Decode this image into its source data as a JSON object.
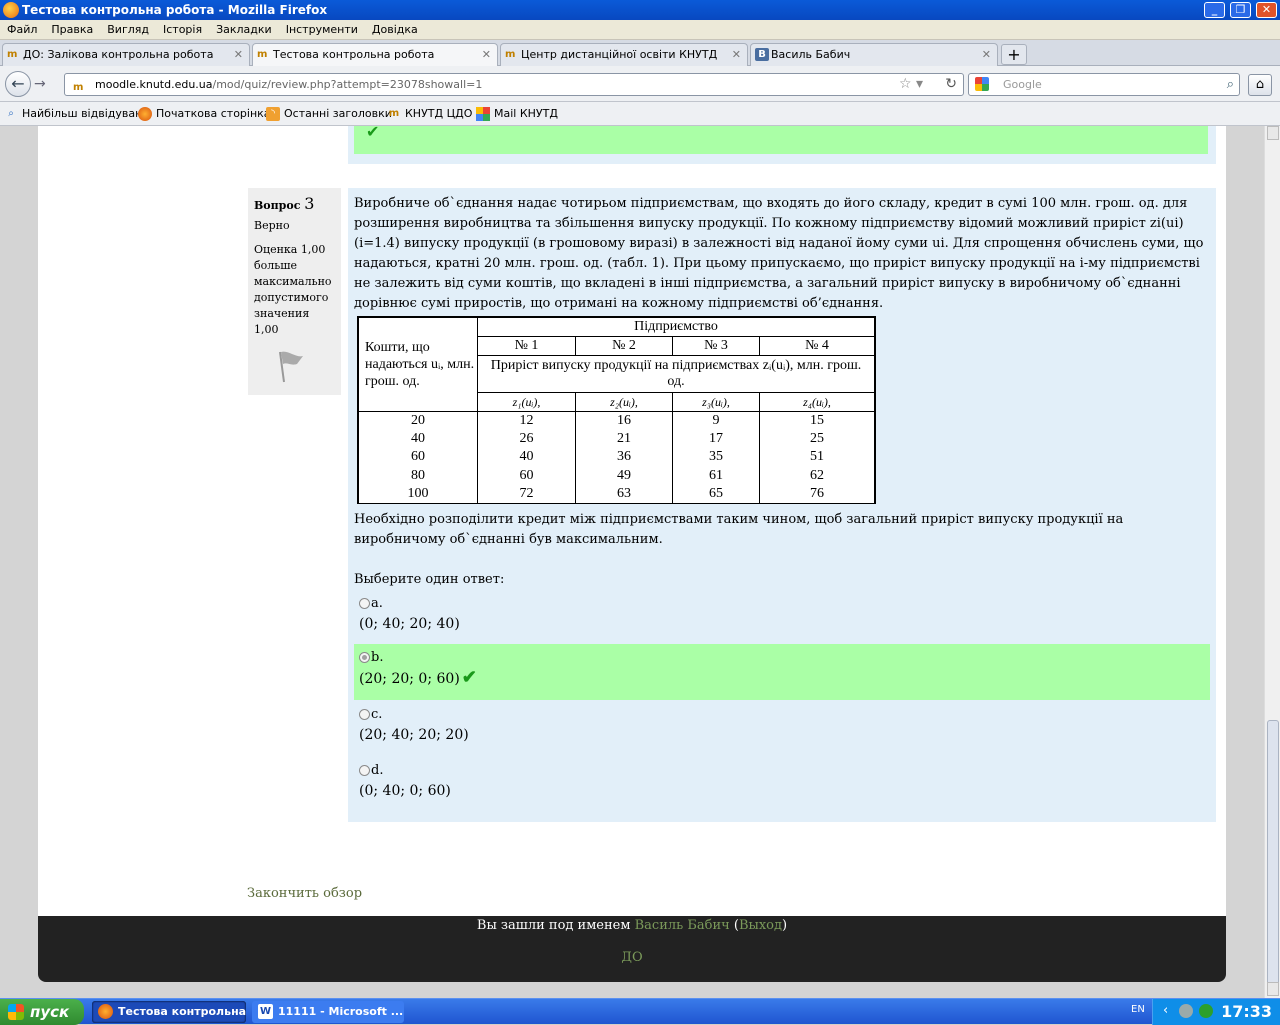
{
  "window": {
    "title": "Тестова контрольна робота - Mozilla Firefox"
  },
  "menu": [
    "Файл",
    "Правка",
    "Вигляд",
    "Історія",
    "Закладки",
    "Інструменти",
    "Довідка"
  ],
  "tabs": [
    {
      "label": "ДО: Залікова контрольна робота",
      "icon": "moodle-icon"
    },
    {
      "label": "Тестова контрольна робота",
      "icon": "moodle-icon",
      "active": true
    },
    {
      "label": "Центр дистанційної освіти КНУТД",
      "icon": "moodle-icon"
    },
    {
      "label": "Василь Бабич",
      "icon": "vk-icon"
    }
  ],
  "address": {
    "domain": "moodle.knutd.edu.ua",
    "path": "/mod/quiz/review.php?attempt=23078showall=1"
  },
  "search": {
    "placeholder": "Google"
  },
  "bookmarks": [
    "Найбільш відвідувані",
    "Початкова сторінка",
    "Останні заголовки",
    "КНУТД ЦДО",
    "Mail КНУТД"
  ],
  "question": {
    "label": "Вопрос",
    "number": "3",
    "state": "Верно",
    "grade": "Оценка 1,00 больше максимально допустимого значения 1,00",
    "text": "Виробниче об`єднання надає чотирьом підприємствам, що входять до його складу, кредит в сумі 100 млн. грош. од. для розширення виробництва та збільшення випуску продукції. По кожному підприємству відомий можливий приріст zi(ui) (i=1.4) випуску продукції (в грошовому виразі) в залежності від наданої йому суми ui. Для спрощення обчислень суми, що надаються, кратні 20 млн. грош. од. (табл. 1). При цьому припускаємо, що приріст випуску продукції на i-му підприємстві не залежить від суми коштів, що вкладені в інші підприємства, а загальний приріст випуску в виробничому об`єднанні дорівнює сумі приростів, що отримані на кожному підприємстві об’єднання.",
    "text2": "Необхідно розподілити кредит між підприємствами таким чином, щоб загальний приріст випуску продукції на виробничому об`єднанні був максимальним.",
    "prompt": "Выберите один ответ:",
    "table": {
      "col1_header": "Кошти, що надаються uᵢ, млн. грош. од.",
      "group_header": "Підприємство",
      "enterprises": [
        "№ 1",
        "№ 2",
        "№ 3",
        "№ 4"
      ],
      "subheader": "Приріст випуску продукції на підприємствах zᵢ(uᵢ), млн. грош. од.",
      "func_labels": [
        "z₁(uᵢ),",
        "z₂(uᵢ),",
        "z₃(uᵢ),",
        "z₄(uᵢ),"
      ],
      "rows": [
        [
          "20",
          "12",
          "16",
          "9",
          "15"
        ],
        [
          "40",
          "26",
          "21",
          "17",
          "25"
        ],
        [
          "60",
          "40",
          "36",
          "35",
          "51"
        ],
        [
          "80",
          "60",
          "49",
          "61",
          "62"
        ],
        [
          "100",
          "72",
          "63",
          "65",
          "76"
        ]
      ]
    },
    "answers": [
      {
        "letter": "a.",
        "value": "(0; 40; 20; 40)",
        "selected": false,
        "correct": false
      },
      {
        "letter": "b.",
        "value": "(20; 20; 0; 60)",
        "selected": true,
        "correct": true
      },
      {
        "letter": "c.",
        "value": "(20; 40; 20; 20)",
        "selected": false,
        "correct": false
      },
      {
        "letter": "d.",
        "value": "(0; 40; 0; 60)",
        "selected": false,
        "correct": false
      }
    ]
  },
  "finish_review": "Закончить обзор",
  "footer": {
    "logged_as": "Вы зашли под именем",
    "user": "Василь Бабич",
    "logout": "Выход",
    "site": "ДО"
  },
  "taskbar": {
    "start": "пуск",
    "items": [
      "Тестова контрольна...",
      "11111 - Microsoft ..."
    ],
    "lang": "EN",
    "clock": "17:33"
  },
  "colors": {
    "correct_bg": "#aaffa6",
    "question_bg": "#e2eff9",
    "link": "#7b9a5a",
    "footer_bg": "#222222"
  }
}
